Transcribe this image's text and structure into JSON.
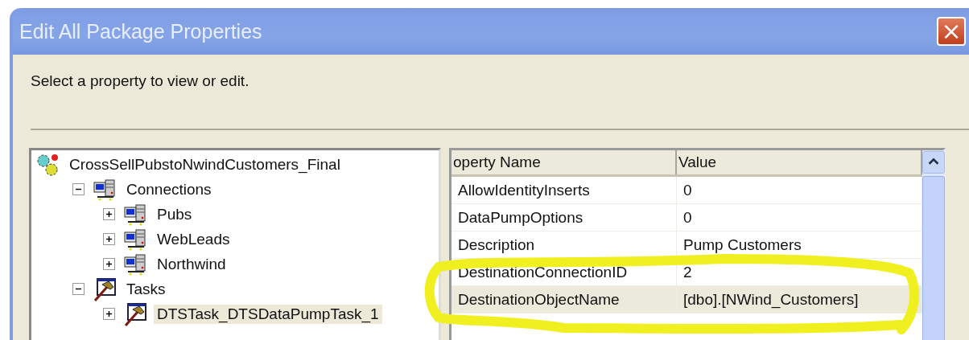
{
  "window": {
    "title": "Edit All Package Properties",
    "close": "×"
  },
  "prompt": "Select a property to view or edit.",
  "tree": [
    {
      "label": "CrossSellPubstoNwindCustomers_Final",
      "kind": "package",
      "selected": false,
      "children": [
        {
          "label": "Connections",
          "kind": "connections",
          "expanded": true,
          "selected": false,
          "children": [
            {
              "label": "Pubs",
              "kind": "connection",
              "expanded": false,
              "selected": false
            },
            {
              "label": "WebLeads",
              "kind": "connection",
              "expanded": false,
              "selected": false
            },
            {
              "label": "Northwind",
              "kind": "connection",
              "expanded": false,
              "selected": false
            }
          ]
        },
        {
          "label": "Tasks",
          "kind": "tasks",
          "expanded": true,
          "selected": false,
          "children": [
            {
              "label": "DTSTask_DTSDataPumpTask_1",
              "kind": "task",
              "expanded": false,
              "selected": true
            }
          ]
        }
      ]
    }
  ],
  "table": {
    "columns": [
      "operty Name",
      "Value"
    ],
    "rows": [
      {
        "name": "AllowIdentityInserts",
        "value": "0",
        "selected": false
      },
      {
        "name": "DataPumpOptions",
        "value": "0",
        "selected": false
      },
      {
        "name": "Description",
        "value": "Pump Customers",
        "selected": false
      },
      {
        "name": "DestinationConnectionID",
        "value": "2",
        "selected": false
      },
      {
        "name": "DestinationObjectName",
        "value": "[dbo].[NWind_Customers]",
        "selected": true
      }
    ]
  }
}
